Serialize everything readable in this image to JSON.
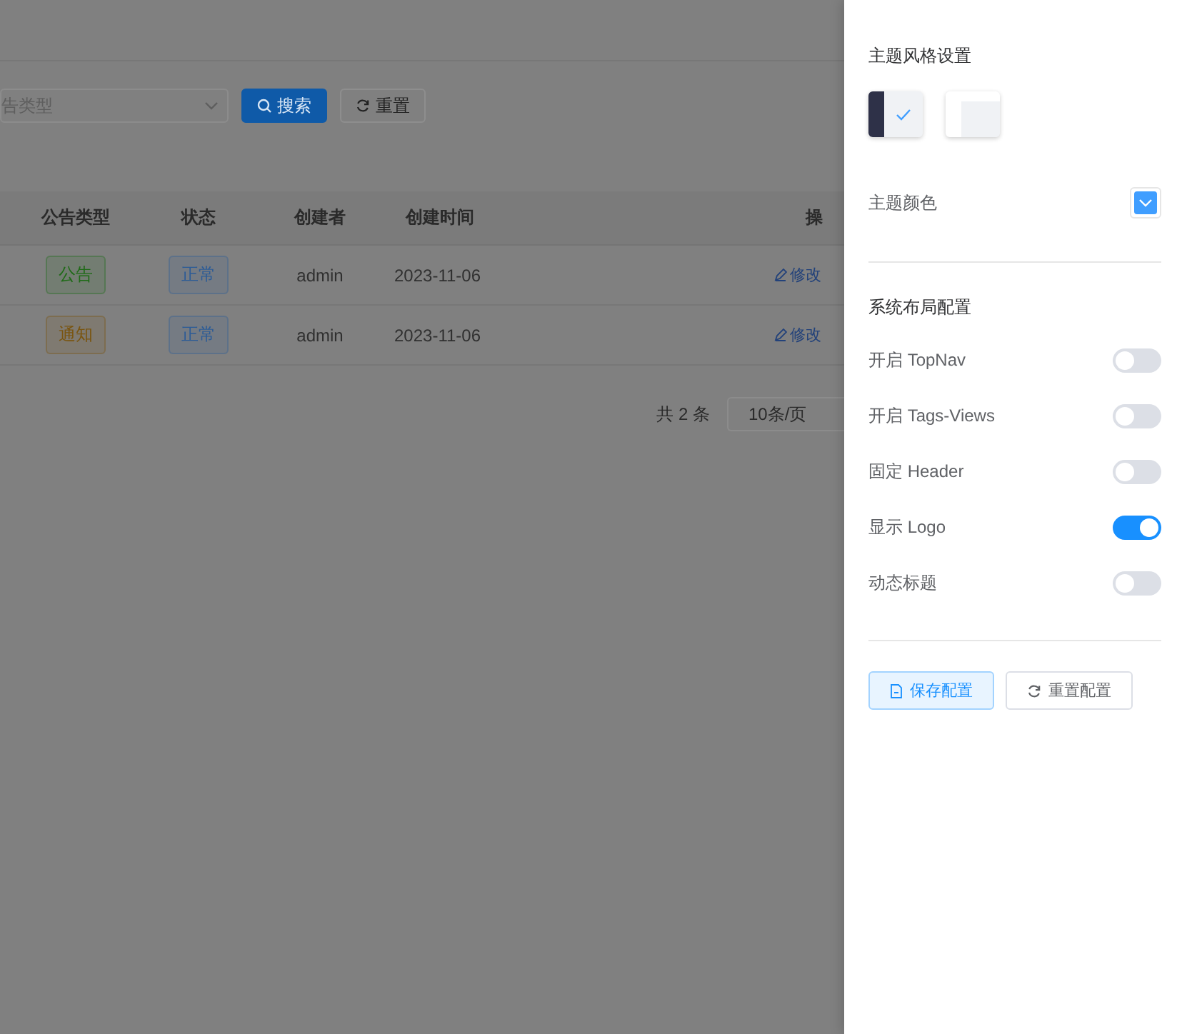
{
  "search_form": {
    "type_select": {
      "placeholder": "告类型"
    },
    "buttons": [
      {
        "kind": "primary",
        "label": "搜索"
      },
      {
        "kind": "plain",
        "label": "重置"
      }
    ]
  },
  "table": {
    "columns": [
      "公告类型",
      "状态",
      "创建者",
      "创建时间",
      "操"
    ],
    "rows": [
      {
        "type": {
          "text": "公告",
          "color": "#1f6b17"
        },
        "status": {
          "text": "正常",
          "color": "#2d5c96"
        },
        "creator": "admin",
        "created": "2023-11-06",
        "action": "修改"
      },
      {
        "type": {
          "text": "通知",
          "color": "#7a5510"
        },
        "status": {
          "text": "正常",
          "color": "#2d5c96"
        },
        "creator": "admin",
        "created": "2023-11-06",
        "action": "修改"
      }
    ]
  },
  "pagination": {
    "total": "共 2 条",
    "page_size": "10条/页"
  },
  "settings": {
    "theme_style": {
      "title": "主题风格设置",
      "options": [
        {
          "kind": "dark",
          "selected": true
        },
        {
          "kind": "light",
          "selected": false
        }
      ]
    },
    "theme_color": {
      "label": "主题颜色",
      "color": "#409eff"
    },
    "layout": {
      "title": "系统布局配置",
      "toggles": [
        {
          "label": "开启 TopNav",
          "on": false
        },
        {
          "label": "开启 Tags-Views",
          "on": false
        },
        {
          "label": "固定 Header",
          "on": false
        },
        {
          "label": "显示 Logo",
          "on": true
        },
        {
          "label": "动态标题",
          "on": false
        }
      ]
    },
    "buttons": [
      {
        "kind": "primary",
        "label": "保存配置"
      },
      {
        "kind": "plain",
        "label": "重置配置"
      }
    ]
  }
}
